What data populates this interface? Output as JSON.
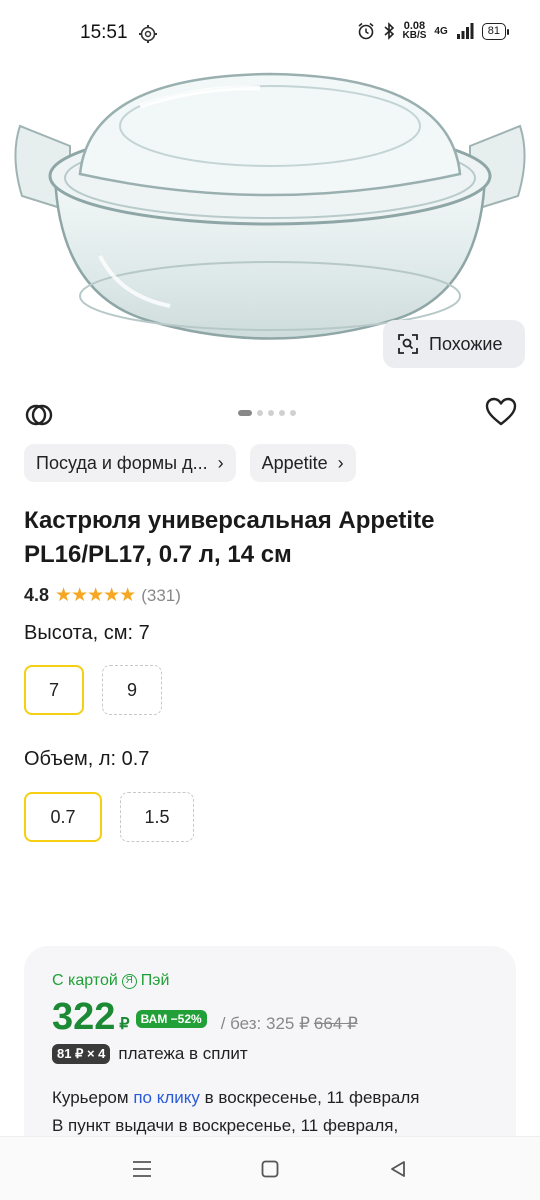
{
  "status_bar": {
    "time": "15:51",
    "net_speed": "0.08",
    "net_unit": "KB/S",
    "signal": "4G",
    "battery": "81"
  },
  "gallery": {
    "similar_label": "Похожие",
    "pages": 5,
    "active_page": 1
  },
  "breadcrumbs": [
    {
      "label": "Посуда и формы д..."
    },
    {
      "label": "Appetite"
    }
  ],
  "product": {
    "title": "Кастрюля универсальная Appetite PL16/PL17, 0.7 л, 14 см",
    "rating": "4.8",
    "stars": "★★★★★",
    "reviews": "(331)"
  },
  "options": {
    "height": {
      "label": "Высота, см: 7",
      "values": [
        "7",
        "9"
      ],
      "selected": "7"
    },
    "volume": {
      "label": "Объем, л: 0.7",
      "values": [
        "0.7",
        "1.5"
      ],
      "selected": "0.7"
    }
  },
  "price": {
    "card_label": "С картой",
    "pay_label": "Пэй",
    "ya_letter": "Я",
    "amount": "322",
    "currency": "₽",
    "badge": "ВАМ −52%",
    "without_label": "/ без: 325 ₽",
    "old_price": "664 ₽",
    "split_badge": "81 ₽ × 4",
    "split_text": "платежа в сплит"
  },
  "delivery": {
    "courier_prefix": "Курьером",
    "courier_link": "по клику",
    "courier_suffix": "в воскресенье, 11 февраля",
    "pickup": "В пункт выдачи в воскресенье, 11 февраля,"
  },
  "colors": {
    "accent_yellow": "#f5cf11",
    "price_green": "#1c8a34",
    "link_blue": "#2a5bd7",
    "star": "#f5a623"
  }
}
